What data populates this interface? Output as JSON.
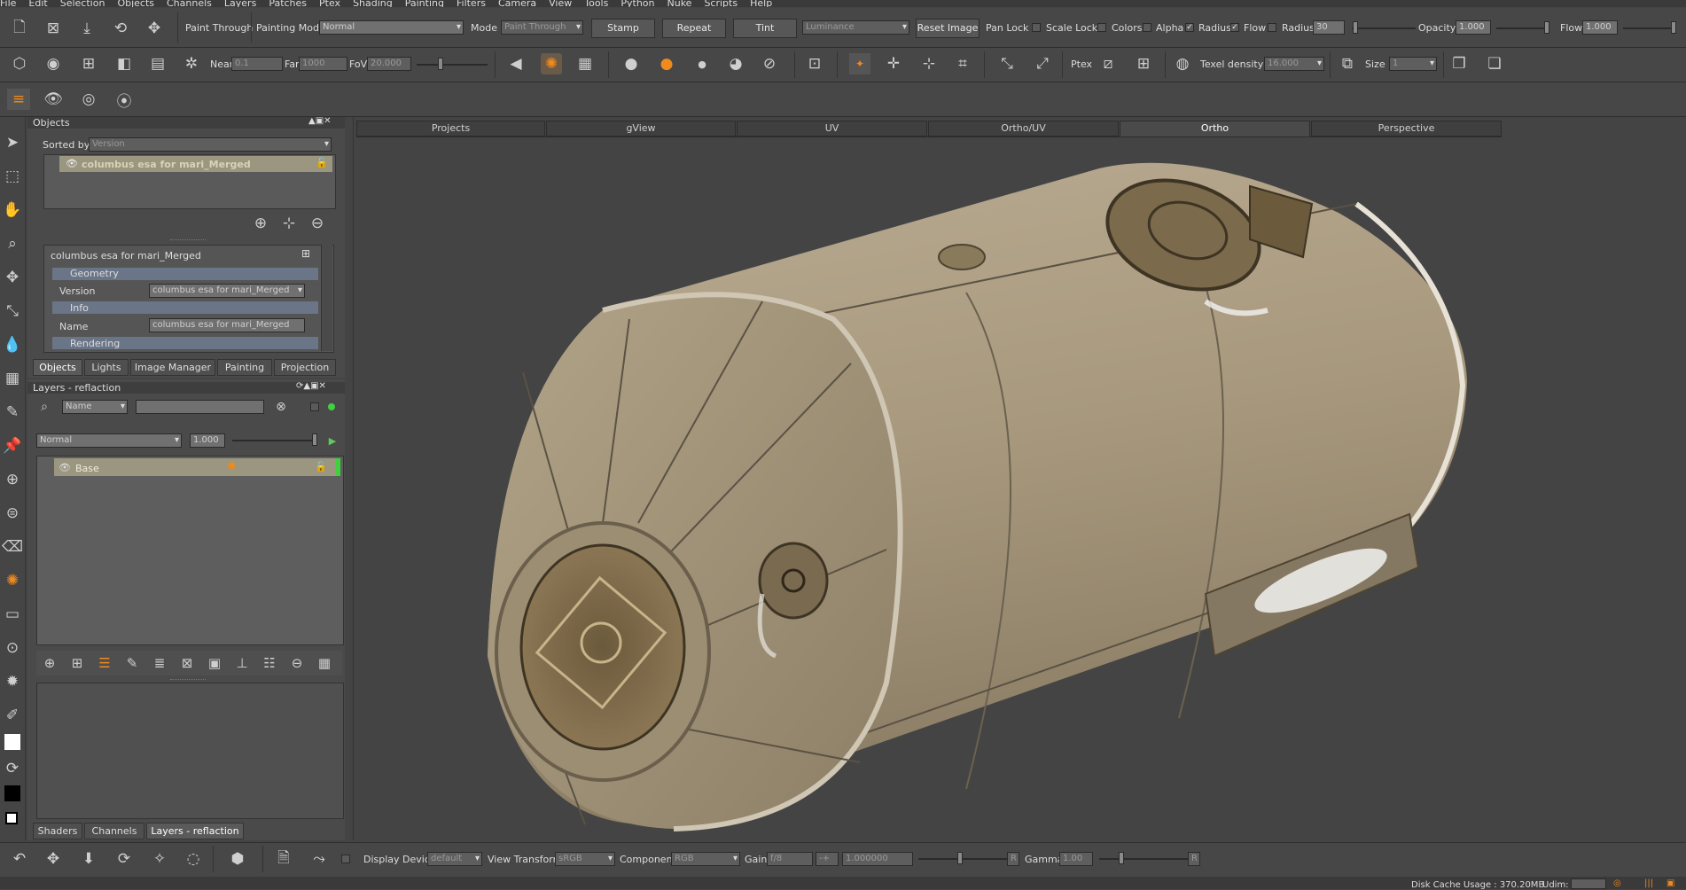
{
  "menu": [
    "File",
    "Edit",
    "Selection",
    "Objects",
    "Channels",
    "Layers",
    "Patches",
    "Ptex",
    "Shading",
    "Painting",
    "Filters",
    "Camera",
    "View",
    "Tools",
    "Python",
    "Nuke",
    "Scripts",
    "Help"
  ],
  "toolbar1": {
    "paint_through_label": "Paint Through",
    "painting_mode_label": "Painting Mode",
    "painting_mode_value": "Normal",
    "mode_label": "Mode",
    "mode_value": "Paint Through",
    "stamp": "Stamp",
    "repeat": "Repeat",
    "tint": "Tint",
    "luminance_value": "Luminance",
    "reset_image": "Reset Image",
    "pan_lock": "Pan Lock",
    "scale_lock": "Scale Lock",
    "colors": "Colors",
    "alpha": "Alpha",
    "radius_label": "Radius",
    "flow_label": "Flow",
    "radius_value_label": "Radius",
    "radius_value": "30",
    "opacity_label": "Opacity",
    "opacity_value": "1.000",
    "flow_value_label": "Flow",
    "flow_value": "1.000"
  },
  "toolbar2": {
    "near_label": "Near",
    "near_value": "0.1",
    "far_label": "Far",
    "far_value": "1000",
    "fov_label": "FoV",
    "fov_value": "20.000",
    "ptex_label": "Ptex",
    "texel_label": "Texel density",
    "texel_value": "16.000",
    "size_label": "Size",
    "size_value": "1"
  },
  "objects_panel": {
    "title": "Objects",
    "sorted_by_label": "Sorted by",
    "sorted_by_value": "Version",
    "object_item": "columbus esa for mari_Merged",
    "props_title": "columbus esa for mari_Merged",
    "geometry_section": "Geometry",
    "version_label": "Version",
    "version_value": "columbus esa for mari_Merged",
    "info_section": "Info",
    "name_label": "Name",
    "name_value": "columbus esa for mari_Merged",
    "rendering_section": "Rendering",
    "tabs": [
      "Objects",
      "Lights",
      "Image Manager",
      "Painting",
      "Projection"
    ]
  },
  "layers_panel": {
    "title": "Layers - reflaction",
    "filter_value": "Name",
    "blend_value": "Normal",
    "opacity_value": "1.000",
    "layer_name": "Base",
    "tabs": [
      "Shaders",
      "Channels",
      "Layers - reflaction"
    ]
  },
  "viewport": {
    "tabs": [
      "Projects",
      "gView",
      "UV",
      "Ortho/UV",
      "Ortho",
      "Perspective"
    ],
    "active_tab": "Ortho"
  },
  "bottombar": {
    "display_device_label": "Display Device",
    "display_device_value": "default",
    "view_transform_label": "View Transform",
    "view_transform_value": "sRGB",
    "component_label": "Component",
    "component_value": "RGB",
    "gain_label": "Gain",
    "gain_value": "f/8",
    "gain_number": "1.000000",
    "gamma_label": "Gamma",
    "gamma_value": "1.00"
  },
  "status": {
    "disk_cache": "Disk Cache Usage : 370.20MB",
    "udim": "Udim:"
  },
  "colors": {
    "accent": "#f08a1c",
    "panel": "#4a4a4a",
    "viewport": "#444444",
    "layer_active": "#3fd23f"
  }
}
